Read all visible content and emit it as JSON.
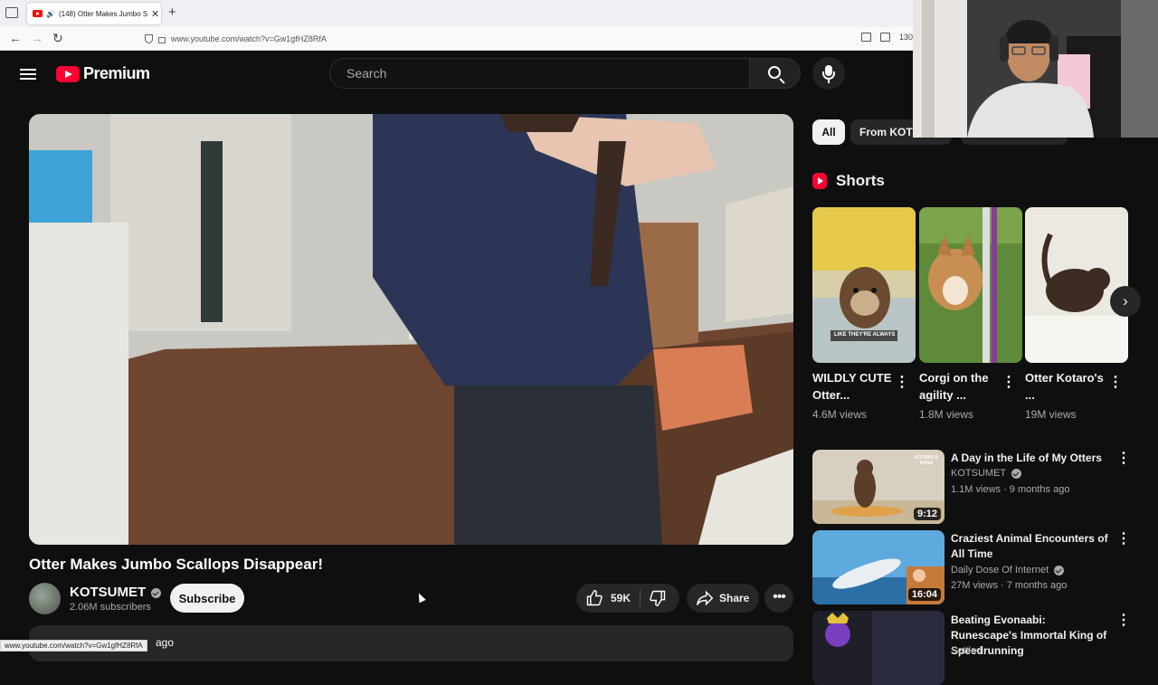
{
  "browser": {
    "tab_title": "(148) Otter Makes Jumbo S",
    "tab_close": "✕",
    "new_tab": "+",
    "url": "www.youtube.com/watch?v=Gw1gfHZ8RfA",
    "zoom": "130",
    "status_url": "www.youtube.com/watch?v=Gw1gfHZ8RfA"
  },
  "header": {
    "logo_text": "Premium",
    "search_placeholder": "Search"
  },
  "video": {
    "title": "Otter Makes Jumbo Scallops Disappear!",
    "channel": "KOTSUMET",
    "subscribers": "2.06M subscribers",
    "subscribe_label": "Subscribe",
    "likes": "59K",
    "share_label": "Share",
    "more_label": "•••",
    "description_snippet": "ago"
  },
  "filters": {
    "all": "All",
    "from": "From KOTS"
  },
  "shorts": {
    "heading": "Shorts",
    "items": [
      {
        "title": "WILDLY CUTE Otter...",
        "views": "4.6M views",
        "caption": "LIKE THEY'RE ALWAYS"
      },
      {
        "title": "Corgi on the agility ...",
        "views": "1.8M views"
      },
      {
        "title": "Otter Kotaro's ...",
        "views": "19M views"
      }
    ]
  },
  "related": [
    {
      "title": "A Day in the Life of My Otters",
      "channel": "KOTSUMET",
      "meta": "1.1M views · 9 months ago",
      "duration": "9:12",
      "thumb_text": "KOTARO & HANA"
    },
    {
      "title": "Craziest Animal Encounters of All Time",
      "channel": "Daily Dose Of Internet",
      "meta": "27M views · 7 months ago",
      "duration": "16:04"
    },
    {
      "title": "Beating Evonaabi: Runescape's Immortal King of Speedrunning",
      "channel": "Settled",
      "meta": "",
      "duration": ""
    }
  ],
  "colors": {
    "background": "#0f0f0f",
    "brand_red": "#ff0033",
    "chip_bg": "#272727",
    "text_secondary": "#aaaaaa"
  }
}
